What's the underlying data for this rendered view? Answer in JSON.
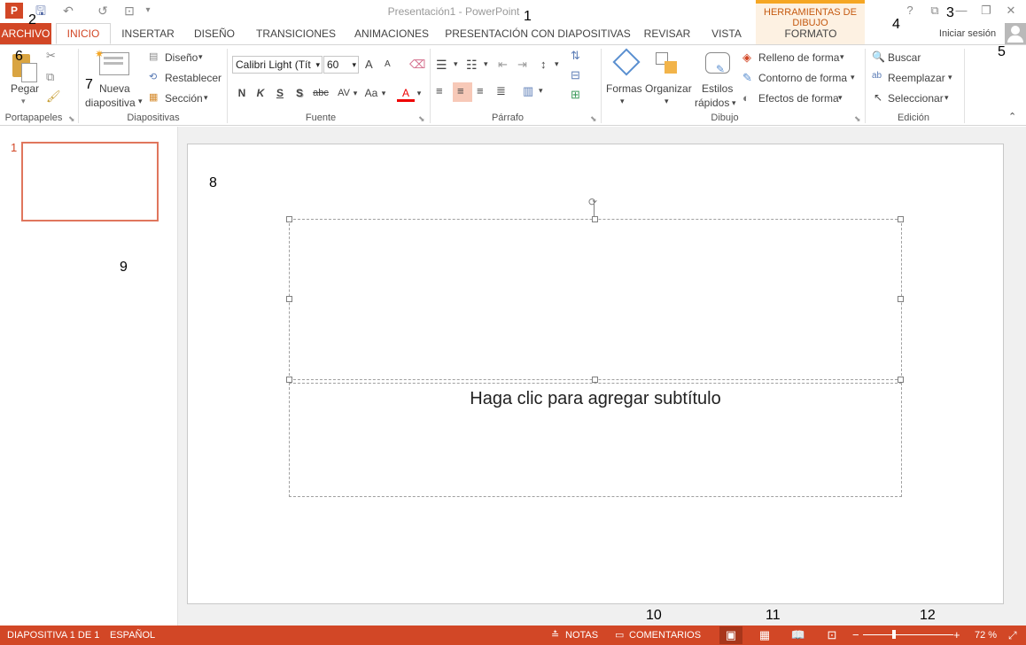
{
  "window": {
    "title": "Presentación1 - PowerPoint",
    "help": "?",
    "ribbon_display": "⧉",
    "minimize": "—",
    "restore": "❐",
    "close": "✕"
  },
  "quick_access": {
    "app_icon": "P",
    "save": "🖫",
    "undo": "↶",
    "redo": "↺",
    "present": "⊡",
    "customize": "▾"
  },
  "tabs": {
    "file": "ARCHIVO",
    "items": [
      "INICIO",
      "INSERTAR",
      "DISEÑO",
      "TRANSICIONES",
      "ANIMACIONES",
      "PRESENTACIÓN CON DIAPOSITIVAS",
      "REVISAR",
      "VISTA",
      "FORMATO"
    ],
    "tools_label": "HERRAMIENTAS DE DIBUJO",
    "sign_in": "Iniciar sesión"
  },
  "ribbon": {
    "clipboard": {
      "paste": "Pegar",
      "label": "Portapapeles"
    },
    "slides": {
      "new_slide_1": "Nueva",
      "new_slide_2": "diapositiva",
      "layout": "Diseño",
      "reset": "Restablecer",
      "section": "Sección",
      "label": "Diapositivas"
    },
    "font": {
      "font_name": "Calibri Light (Tít",
      "font_size": "60",
      "bold": "N",
      "italic": "K",
      "underline": "S",
      "shadow": "S",
      "strike": "abc",
      "spacing": "AV",
      "case": "Aa",
      "color": "A",
      "grow": "A",
      "shrink": "A",
      "label": "Fuente"
    },
    "paragraph": {
      "label": "Párrafo"
    },
    "drawing": {
      "shapes": "Formas",
      "arrange": "Organizar",
      "quick_styles_1": "Estilos",
      "quick_styles_2": "rápidos",
      "fill": "Relleno de forma",
      "outline": "Contorno de forma",
      "effects": "Efectos de forma",
      "label": "Dibujo"
    },
    "editing": {
      "find": "Buscar",
      "replace": "Reemplazar",
      "select": "Seleccionar",
      "label": "Edición"
    }
  },
  "slide": {
    "number": "1",
    "subtitle_placeholder": "Haga clic para agregar subtítulo"
  },
  "status": {
    "slide_info": "DIAPOSITIVA 1 DE 1",
    "language": "ESPAÑOL",
    "notes": "NOTAS",
    "comments": "COMENTARIOS",
    "zoom": "72 %",
    "zoom_level_percent": 72
  },
  "callouts": [
    "1",
    "2",
    "3",
    "4",
    "5",
    "6",
    "7",
    "8",
    "9",
    "10",
    "11",
    "12"
  ],
  "colors": {
    "accent": "#d24726",
    "tools": "#f5a623"
  }
}
